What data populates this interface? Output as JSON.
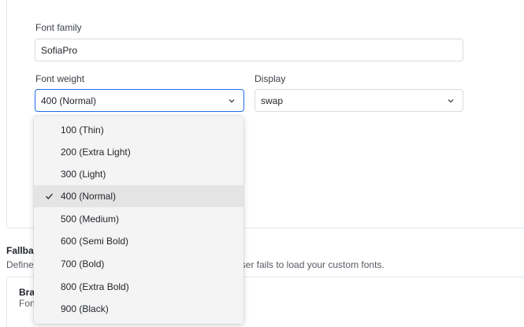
{
  "font_family": {
    "label": "Font family",
    "value": "SofiaPro"
  },
  "font_weight": {
    "label": "Font weight",
    "value": "400 (Normal)",
    "options": [
      "100 (Thin)",
      "200 (Extra Light)",
      "300 (Light)",
      "400 (Normal)",
      "500 (Medium)",
      "600 (Semi Bold)",
      "700 (Bold)",
      "800 (Extra Bold)",
      "900 (Black)"
    ],
    "selected_index": 3
  },
  "display": {
    "label": "Display",
    "value": "swap"
  },
  "fallback": {
    "title": "Fallbac",
    "description_left": "Define",
    "description_right": "wser fails to load your custom fonts.",
    "card_title": "Bran",
    "card_subtitle": "Font"
  },
  "icons": {
    "chevron": "chevron-down-icon",
    "check": "check-icon"
  },
  "colors": {
    "focus_border": "#1f6feb",
    "menu_bg": "#f4f4f4",
    "selected_bg": "#e4e4e4"
  }
}
